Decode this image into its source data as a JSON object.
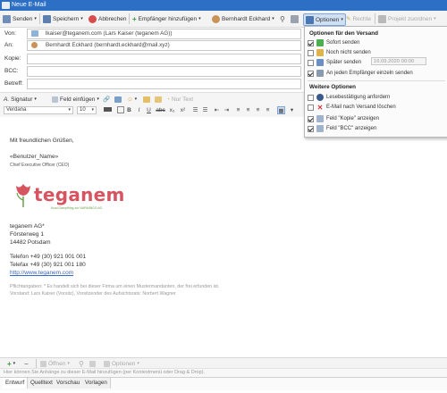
{
  "window": {
    "title": "Neue E-Mail"
  },
  "toolbar": {
    "send": "Senden",
    "save": "Speichern",
    "cancel": "Abbrechen",
    "add_recipient": "Empfänger hinzufügen",
    "contact": "Bernhardt Eckhard",
    "options": "Optionen",
    "rights": "Rechte",
    "assign_project": "Projekt zuordnen"
  },
  "fields": {
    "from_label": "Von:",
    "from_value": "lkaiser@teganem.com (Lars Kaiser (teganem AG))",
    "to_label": "An:",
    "to_value": "Bernhardt Eckhard (bernhardt.eckhard@mail.xyz)",
    "cc_label": "Kopie:",
    "bcc_label": "BCC:",
    "subject_label": "Betreff:"
  },
  "format_bar": {
    "signature": "Signatur",
    "insert_field": "Feld einfügen",
    "text_only": "Nur Text",
    "font": "Verdana",
    "size": "10"
  },
  "body": {
    "greeting": "Mit freundlichen Grüßen,",
    "user_name": "«Benutzer_Name»",
    "position": "Chief Executive Officer (CEO)",
    "logo_text": "teganem",
    "logo_tagline": "Kuwi Dampfhing zur NARMINGO AG",
    "company": "teganem AG*",
    "street": "Försterweg 1",
    "city": "14482 Potsdam",
    "phone": "Telefon  +49 (30) 921 001 001",
    "fax": "Telefax  +49 (30) 921 001 180",
    "website": "http://www.teganem.com",
    "disclaimer_1": "Pflichtangaben: * Es handelt sich bei dieser Firma um einen Mustermandanten, der frei erfunden ist.",
    "disclaimer_2": "Vorstand: Lars Kaiser (Vorsitz), Vorsitzender des Aufsichtsrats: Norbert Wagner"
  },
  "attachments": {
    "open": "Öffnen",
    "options": "Optionen",
    "hint": "Hier können Sie Anhänge zu dieser E-Mail hinzufügen (per Kontextmenü oder Drag & Drop)."
  },
  "tabs": [
    {
      "label": "Entwurf"
    },
    {
      "label": "Quelltext"
    },
    {
      "label": "Vorschau"
    },
    {
      "label": "Vorlagen"
    }
  ],
  "options_menu": {
    "section_send": "Optionen für den Versand",
    "send_now": "Sofort senden",
    "dont_send": "Noch nicht senden",
    "send_later": "Später senden",
    "send_later_date": "16.09.2020 00:00",
    "each_recipient": "An jeden Empfänger einzeln senden",
    "section_more": "Weitere Optionen",
    "read_receipt": "Lesebestätigung anfordern",
    "delete_after_send": "E-Mail nach Versand löschen",
    "show_cc": "Feld \"Kopie\" anzeigen",
    "show_bcc": "Feld \"BCC\" anzeigen"
  },
  "colors": {
    "titlebar": "#2d6fc4",
    "brand": "#d6545f",
    "link": "#3a67c2"
  }
}
